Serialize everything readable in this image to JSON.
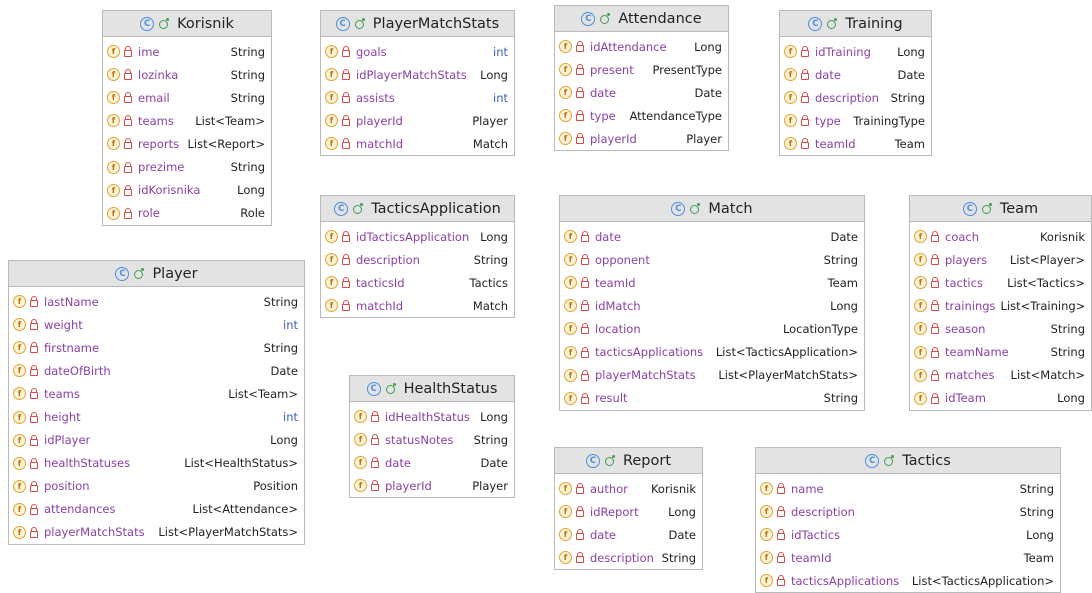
{
  "classes": [
    {
      "name": "Korisnik",
      "fields": [
        {
          "name": "ime",
          "type": "String",
          "primitive": false
        },
        {
          "name": "lozinka",
          "type": "String",
          "primitive": false
        },
        {
          "name": "email",
          "type": "String",
          "primitive": false
        },
        {
          "name": "teams",
          "type": "List<Team>",
          "primitive": false
        },
        {
          "name": "reports",
          "type": "List<Report>",
          "primitive": false
        },
        {
          "name": "prezime",
          "type": "String",
          "primitive": false
        },
        {
          "name": "idKorisnika",
          "type": "Long",
          "primitive": false
        },
        {
          "name": "role",
          "type": "Role",
          "primitive": false
        }
      ]
    },
    {
      "name": "PlayerMatchStats",
      "fields": [
        {
          "name": "goals",
          "type": "int",
          "primitive": true
        },
        {
          "name": "idPlayerMatchStats",
          "type": "Long",
          "primitive": false
        },
        {
          "name": "assists",
          "type": "int",
          "primitive": true
        },
        {
          "name": "playerId",
          "type": "Player",
          "primitive": false
        },
        {
          "name": "matchId",
          "type": "Match",
          "primitive": false
        }
      ]
    },
    {
      "name": "Attendance",
      "fields": [
        {
          "name": "idAttendance",
          "type": "Long",
          "primitive": false
        },
        {
          "name": "present",
          "type": "PresentType",
          "primitive": false
        },
        {
          "name": "date",
          "type": "Date",
          "primitive": false
        },
        {
          "name": "type",
          "type": "AttendanceType",
          "primitive": false
        },
        {
          "name": "playerId",
          "type": "Player",
          "primitive": false
        }
      ]
    },
    {
      "name": "Training",
      "fields": [
        {
          "name": "idTraining",
          "type": "Long",
          "primitive": false
        },
        {
          "name": "date",
          "type": "Date",
          "primitive": false
        },
        {
          "name": "description",
          "type": "String",
          "primitive": false
        },
        {
          "name": "type",
          "type": "TrainingType",
          "primitive": false
        },
        {
          "name": "teamId",
          "type": "Team",
          "primitive": false
        }
      ]
    },
    {
      "name": "Player",
      "fields": [
        {
          "name": "lastName",
          "type": "String",
          "primitive": false
        },
        {
          "name": "weight",
          "type": "int",
          "primitive": true
        },
        {
          "name": "firstname",
          "type": "String",
          "primitive": false
        },
        {
          "name": "dateOfBirth",
          "type": "Date",
          "primitive": false
        },
        {
          "name": "teams",
          "type": "List<Team>",
          "primitive": false
        },
        {
          "name": "height",
          "type": "int",
          "primitive": true
        },
        {
          "name": "idPlayer",
          "type": "Long",
          "primitive": false
        },
        {
          "name": "healthStatuses",
          "type": "List<HealthStatus>",
          "primitive": false
        },
        {
          "name": "position",
          "type": "Position",
          "primitive": false
        },
        {
          "name": "attendances",
          "type": "List<Attendance>",
          "primitive": false
        },
        {
          "name": "playerMatchStats",
          "type": "List<PlayerMatchStats>",
          "primitive": false
        }
      ]
    },
    {
      "name": "TacticsApplication",
      "fields": [
        {
          "name": "idTacticsApplication",
          "type": "Long",
          "primitive": false
        },
        {
          "name": "description",
          "type": "String",
          "primitive": false
        },
        {
          "name": "tacticsId",
          "type": "Tactics",
          "primitive": false
        },
        {
          "name": "matchId",
          "type": "Match",
          "primitive": false
        }
      ]
    },
    {
      "name": "Match",
      "fields": [
        {
          "name": "date",
          "type": "Date",
          "primitive": false
        },
        {
          "name": "opponent",
          "type": "String",
          "primitive": false
        },
        {
          "name": "teamId",
          "type": "Team",
          "primitive": false
        },
        {
          "name": "idMatch",
          "type": "Long",
          "primitive": false
        },
        {
          "name": "location",
          "type": "LocationType",
          "primitive": false
        },
        {
          "name": "tacticsApplications",
          "type": "List<TacticsApplication>",
          "primitive": false
        },
        {
          "name": "playerMatchStats",
          "type": "List<PlayerMatchStats>",
          "primitive": false
        },
        {
          "name": "result",
          "type": "String",
          "primitive": false
        }
      ]
    },
    {
      "name": "Team",
      "fields": [
        {
          "name": "coach",
          "type": "Korisnik",
          "primitive": false
        },
        {
          "name": "players",
          "type": "List<Player>",
          "primitive": false
        },
        {
          "name": "tactics",
          "type": "List<Tactics>",
          "primitive": false
        },
        {
          "name": "trainings",
          "type": "List<Training>",
          "primitive": false
        },
        {
          "name": "season",
          "type": "String",
          "primitive": false
        },
        {
          "name": "teamName",
          "type": "String",
          "primitive": false
        },
        {
          "name": "matches",
          "type": "List<Match>",
          "primitive": false
        },
        {
          "name": "idTeam",
          "type": "Long",
          "primitive": false
        }
      ]
    },
    {
      "name": "HealthStatus",
      "fields": [
        {
          "name": "idHealthStatus",
          "type": "Long",
          "primitive": false
        },
        {
          "name": "statusNotes",
          "type": "String",
          "primitive": false
        },
        {
          "name": "date",
          "type": "Date",
          "primitive": false
        },
        {
          "name": "playerId",
          "type": "Player",
          "primitive": false
        }
      ]
    },
    {
      "name": "Report",
      "fields": [
        {
          "name": "author",
          "type": "Korisnik",
          "primitive": false
        },
        {
          "name": "idReport",
          "type": "Long",
          "primitive": false
        },
        {
          "name": "date",
          "type": "Date",
          "primitive": false
        },
        {
          "name": "description",
          "type": "String",
          "primitive": false
        }
      ]
    },
    {
      "name": "Tactics",
      "fields": [
        {
          "name": "name",
          "type": "String",
          "primitive": false
        },
        {
          "name": "description",
          "type": "String",
          "primitive": false
        },
        {
          "name": "idTactics",
          "type": "Long",
          "primitive": false
        },
        {
          "name": "teamId",
          "type": "Team",
          "primitive": false
        },
        {
          "name": "tacticsApplications",
          "type": "List<TacticsApplication>",
          "primitive": false
        }
      ]
    }
  ]
}
